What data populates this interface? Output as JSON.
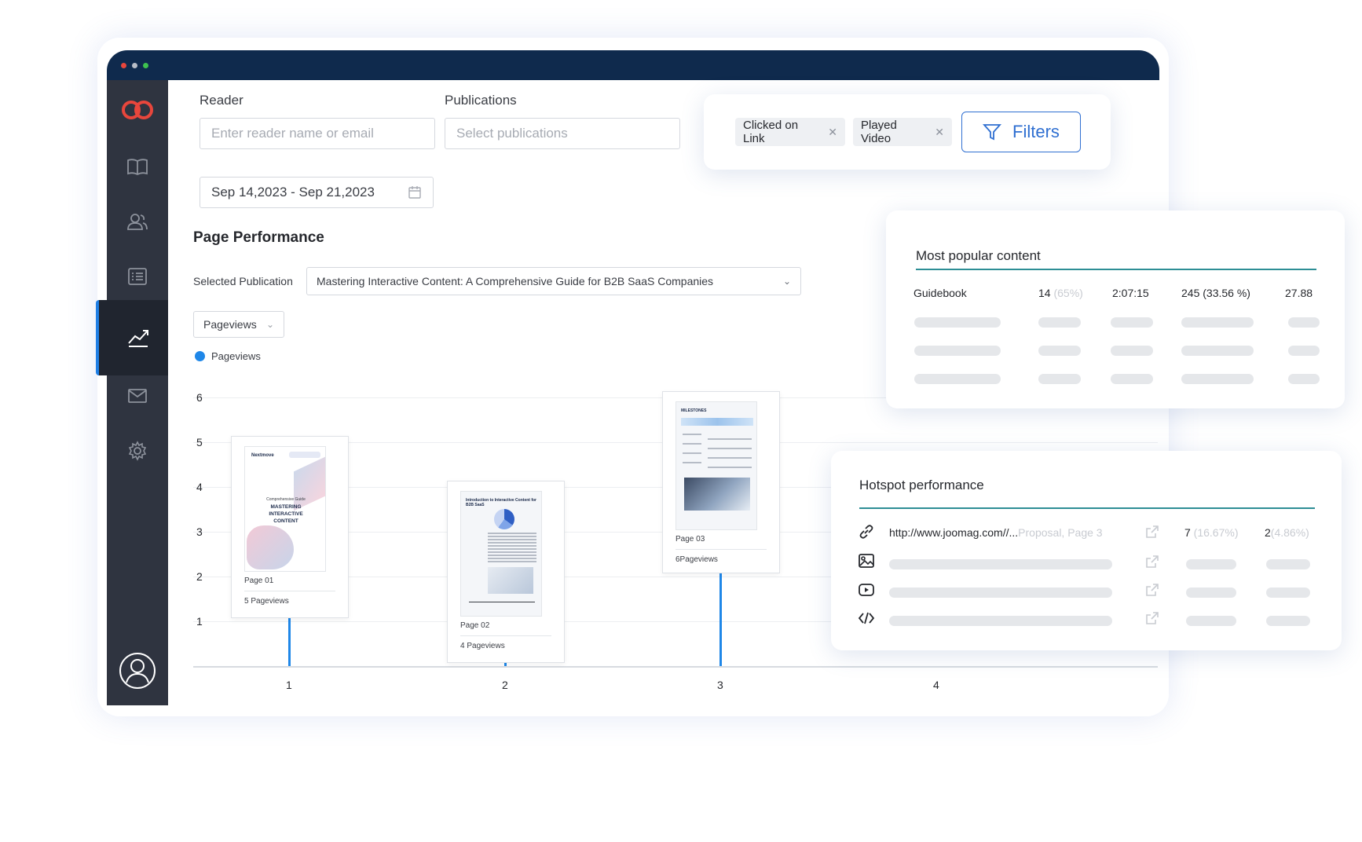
{
  "filters": {
    "reader_label": "Reader",
    "reader_placeholder": "Enter reader name or email",
    "publications_label": "Publications",
    "publications_placeholder": "Select publications",
    "date_range": "Sep 14,2023 -  Sep 21,2023",
    "chips": [
      "Clicked on Link",
      "Played Video"
    ],
    "filters_button": "Filters"
  },
  "page_performance": {
    "title": "Page Performance",
    "selected_publication_label": "Selected Publication",
    "selected_publication": "Mastering Interactive Content: A Comprehensive Guide for B2B SaaS Companies",
    "metric_select": "Pageviews",
    "legend": "Pageviews"
  },
  "thumbnails": {
    "p1_brand": "Nextmove",
    "p1_sub": "Comprehensive Guide",
    "p1_title": "MASTERING INTERACTIVE CONTENT",
    "p2_title": "Introduction to Interactive Content for B2B SaaS",
    "p3_title": "MILESTONES"
  },
  "chart_data": {
    "type": "bar",
    "categories": [
      "1",
      "2",
      "3",
      "4"
    ],
    "values": [
      5,
      4,
      6,
      null
    ],
    "yticks": [
      "1",
      "2",
      "3",
      "4",
      "5",
      "6"
    ],
    "ylim": [
      0,
      6
    ],
    "series": [
      {
        "name": "Pageviews",
        "values": [
          5,
          4,
          6,
          null
        ]
      }
    ],
    "page_labels": [
      "Page 01",
      "Page 02",
      "Page 03"
    ],
    "pageview_labels": [
      "5 Pageviews",
      "4 Pageviews",
      "6Pageviews"
    ],
    "color": "#1f87e8"
  },
  "popular": {
    "title": "Most popular content",
    "row": {
      "name": "Guidebook",
      "count": "14",
      "pct": "(65%)",
      "time": "2:07:15",
      "views": "245 (33.56 %)",
      "score": "27.88"
    }
  },
  "hotspot": {
    "title": "Hotspot performance",
    "row": {
      "url": "http://www.joomag.com//...",
      "detail": "Proposal, Page 3",
      "clicks": "7",
      "clicks_pct": " (16.67%)",
      "other": "2",
      "other_pct": "(4.86%)"
    }
  },
  "colors": {
    "accent": "#1f87e8",
    "nav": "#0f2a4d",
    "sidebar": "#2f3440",
    "logo": "#e8463c",
    "rule": "#2d8e95",
    "filter": "#2f6fd1"
  }
}
